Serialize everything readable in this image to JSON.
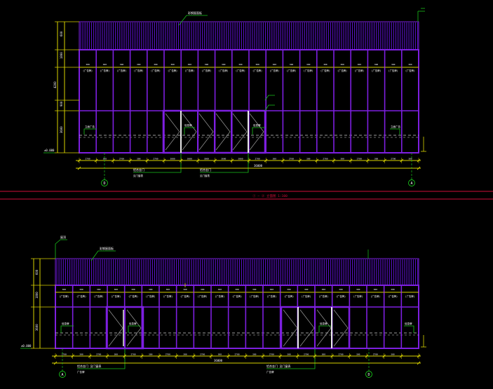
{
  "colors": {
    "background": "#000000",
    "frame": "#7d1fe0",
    "cladding": "#5a10c8",
    "dimension": "#d8d200",
    "leader": "#19c21a",
    "label": "#ffffff",
    "divider": "#d0103a",
    "grid_bubble": "#19c21a",
    "glass": "#e8e8e8",
    "hidden_line": "#cfcfcf"
  },
  "divider_caption": "① – ② 立面图  1:100",
  "top_elevation": {
    "grid_left": "D",
    "grid_right": "A",
    "roof_note": "彩钢屋面板",
    "panel_tag": "(广告牌)",
    "bay_marks": [
      "300",
      "300",
      "300",
      "300",
      "300",
      "300",
      "300",
      "300",
      "300",
      "300",
      "300",
      "300",
      "300",
      "300",
      "300",
      "300",
      "300",
      "300",
      "300",
      "300"
    ],
    "bottom_dims": [
      "2700",
      "300",
      "2700",
      "300",
      "2700",
      "3000",
      "3000",
      "3000",
      "3000",
      "3000",
      "2700",
      "300",
      "2700",
      "300",
      "2700",
      "300",
      "2700",
      "300",
      "2700",
      "300"
    ],
    "overall_dim": "36000",
    "door_note_1": "铝合金门",
    "door_note_2": "铝合金门",
    "door_sub_1": "见门窗表",
    "door_sub_2": "见门窗表",
    "side_tags": [
      "立面广告",
      "信息牌",
      "信息牌",
      "立面广告"
    ],
    "level_label": "±0.000",
    "height_dims": [
      "600",
      "1800",
      "900",
      "3600",
      "4200"
    ]
  },
  "bottom_elevation": {
    "grid_left": "A",
    "grid_right": "D",
    "roof_note": "彩钢屋面板",
    "top_tag": "屋顶",
    "panel_tag": "(广告牌)",
    "bottom_dims": [
      "2700",
      "300",
      "2700",
      "300",
      "2700",
      "300",
      "2700",
      "300",
      "2700",
      "300",
      "2700",
      "300",
      "2700",
      "300",
      "2700",
      "300",
      "2700",
      "300",
      "2700",
      "300"
    ],
    "overall_dim": "36000",
    "door_note_1": "铝合金门 见门窗表",
    "door_note_2": "铝合金门 见门窗表",
    "door_sub_1": "广告牌",
    "door_sub_2": "广告牌",
    "side_tags": [
      "信息牌",
      "信息牌",
      "信息牌",
      "信息牌"
    ],
    "level_label": "±0.000",
    "height_dims": [
      "600",
      "1800",
      "3600"
    ]
  }
}
